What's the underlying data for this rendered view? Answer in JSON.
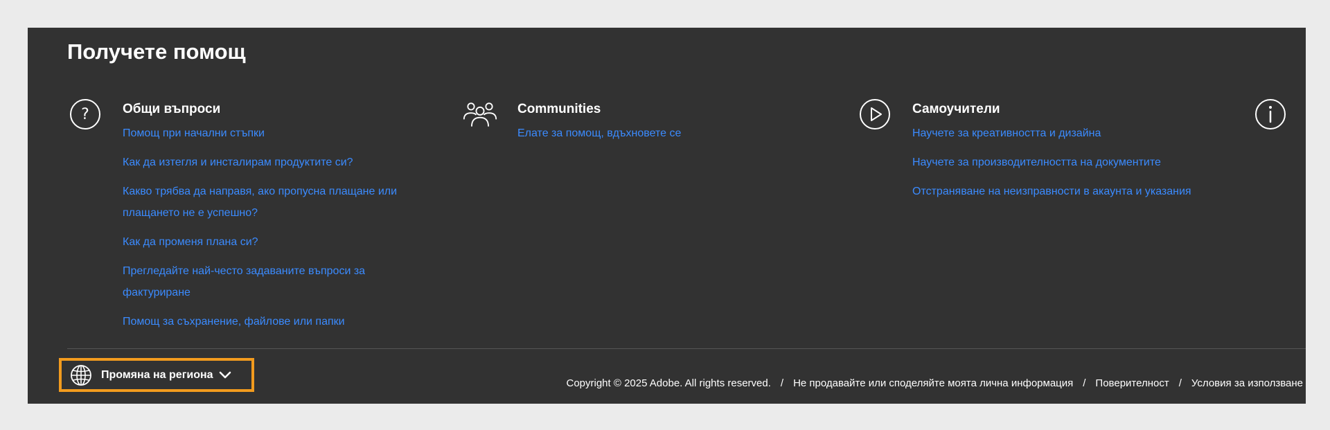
{
  "help": {
    "title": "Получете помощ",
    "columns": [
      {
        "icon": "question-circle-icon",
        "heading": "Общи въпроси",
        "links": [
          "Помощ при начални стъпки",
          "Как да изтегля и инсталирам продуктите си?",
          "Какво трябва да направя, ако пропусна плащане или плащането не е успешно?",
          "Как да променя плана си?",
          "Прегледайте най-често задаваните въпроси за фактуриране",
          "Помощ за съхранение, файлове или папки"
        ]
      },
      {
        "icon": "people-group-icon",
        "heading": "Communities",
        "links": [
          "Елате за помощ, вдъхновете се"
        ]
      },
      {
        "icon": "play-circle-icon",
        "heading": "Самоучители",
        "links": [
          "Научете за креативността и дизайна",
          "Научете за производителността на документите",
          "Отстраняване на неизправности в акаунта и указания"
        ]
      },
      {
        "icon": "info-circle-icon"
      }
    ]
  },
  "footer": {
    "region_label": "Промяна на региона",
    "copyright": "Copyright © 2025 Adobe. All rights reserved.",
    "separator": "/",
    "links": [
      "Не продавайте или споделяйте моята лична информация",
      "Поверителност",
      "Условия за използване"
    ]
  },
  "colors": {
    "panel_background": "#323232",
    "page_background": "#ebebeb",
    "link_blue": "#3b8bff",
    "highlight_orange": "#f29b1e",
    "text_white": "#ffffff"
  }
}
